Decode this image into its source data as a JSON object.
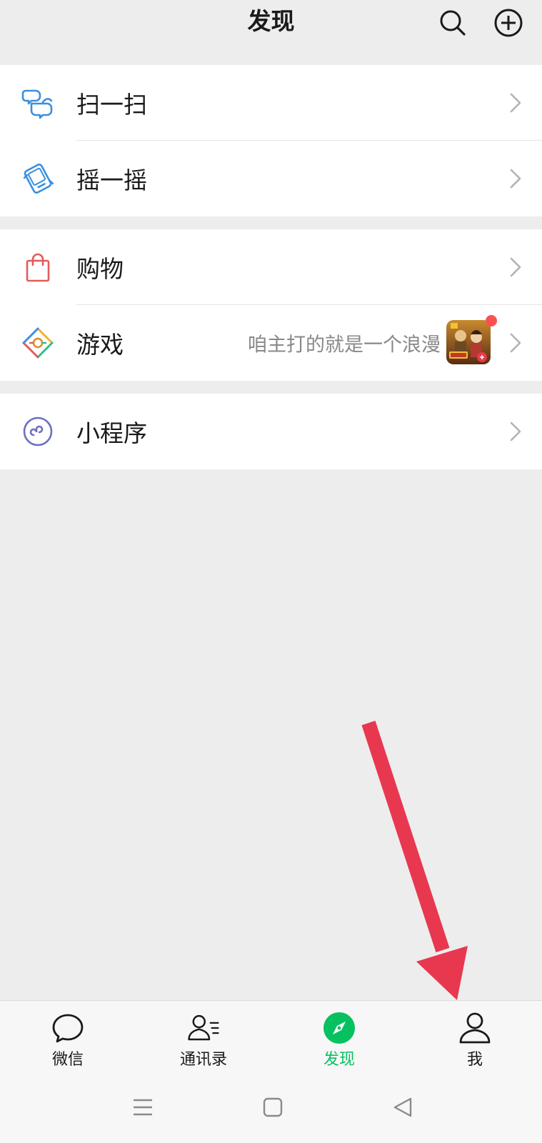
{
  "header": {
    "title": "发现",
    "search_icon": "search-icon",
    "add_icon": "plus-circle-icon"
  },
  "groups": [
    {
      "items": [
        {
          "label": "扫一扫",
          "icon": "scan-icon",
          "color": "#3B8FDE"
        },
        {
          "label": "摇一摇",
          "icon": "shake-icon",
          "color": "#3B8FDE"
        }
      ]
    },
    {
      "items": [
        {
          "label": "购物",
          "icon": "shopping-bag-icon",
          "color": "#E35B5B"
        },
        {
          "label": "游戏",
          "icon": "game-icon",
          "description": "咱主打的就是一个浪漫",
          "has_badge": true
        }
      ]
    },
    {
      "items": [
        {
          "label": "小程序",
          "icon": "mini-program-icon",
          "color": "#6D6FC0"
        }
      ]
    }
  ],
  "tabbar": {
    "tabs": [
      {
        "label": "微信",
        "icon": "chat-bubble-icon",
        "active": false
      },
      {
        "label": "通讯录",
        "icon": "contacts-icon",
        "active": false
      },
      {
        "label": "发现",
        "icon": "compass-icon",
        "active": true
      },
      {
        "label": "我",
        "icon": "person-icon",
        "active": false
      }
    ],
    "active_color": "#07C160"
  },
  "system_nav": {
    "buttons": [
      "menu-icon",
      "home-icon",
      "back-icon"
    ]
  },
  "colors": {
    "background": "#EDEDED",
    "annotation_arrow": "#E8384F",
    "badge": "#FA5151"
  }
}
